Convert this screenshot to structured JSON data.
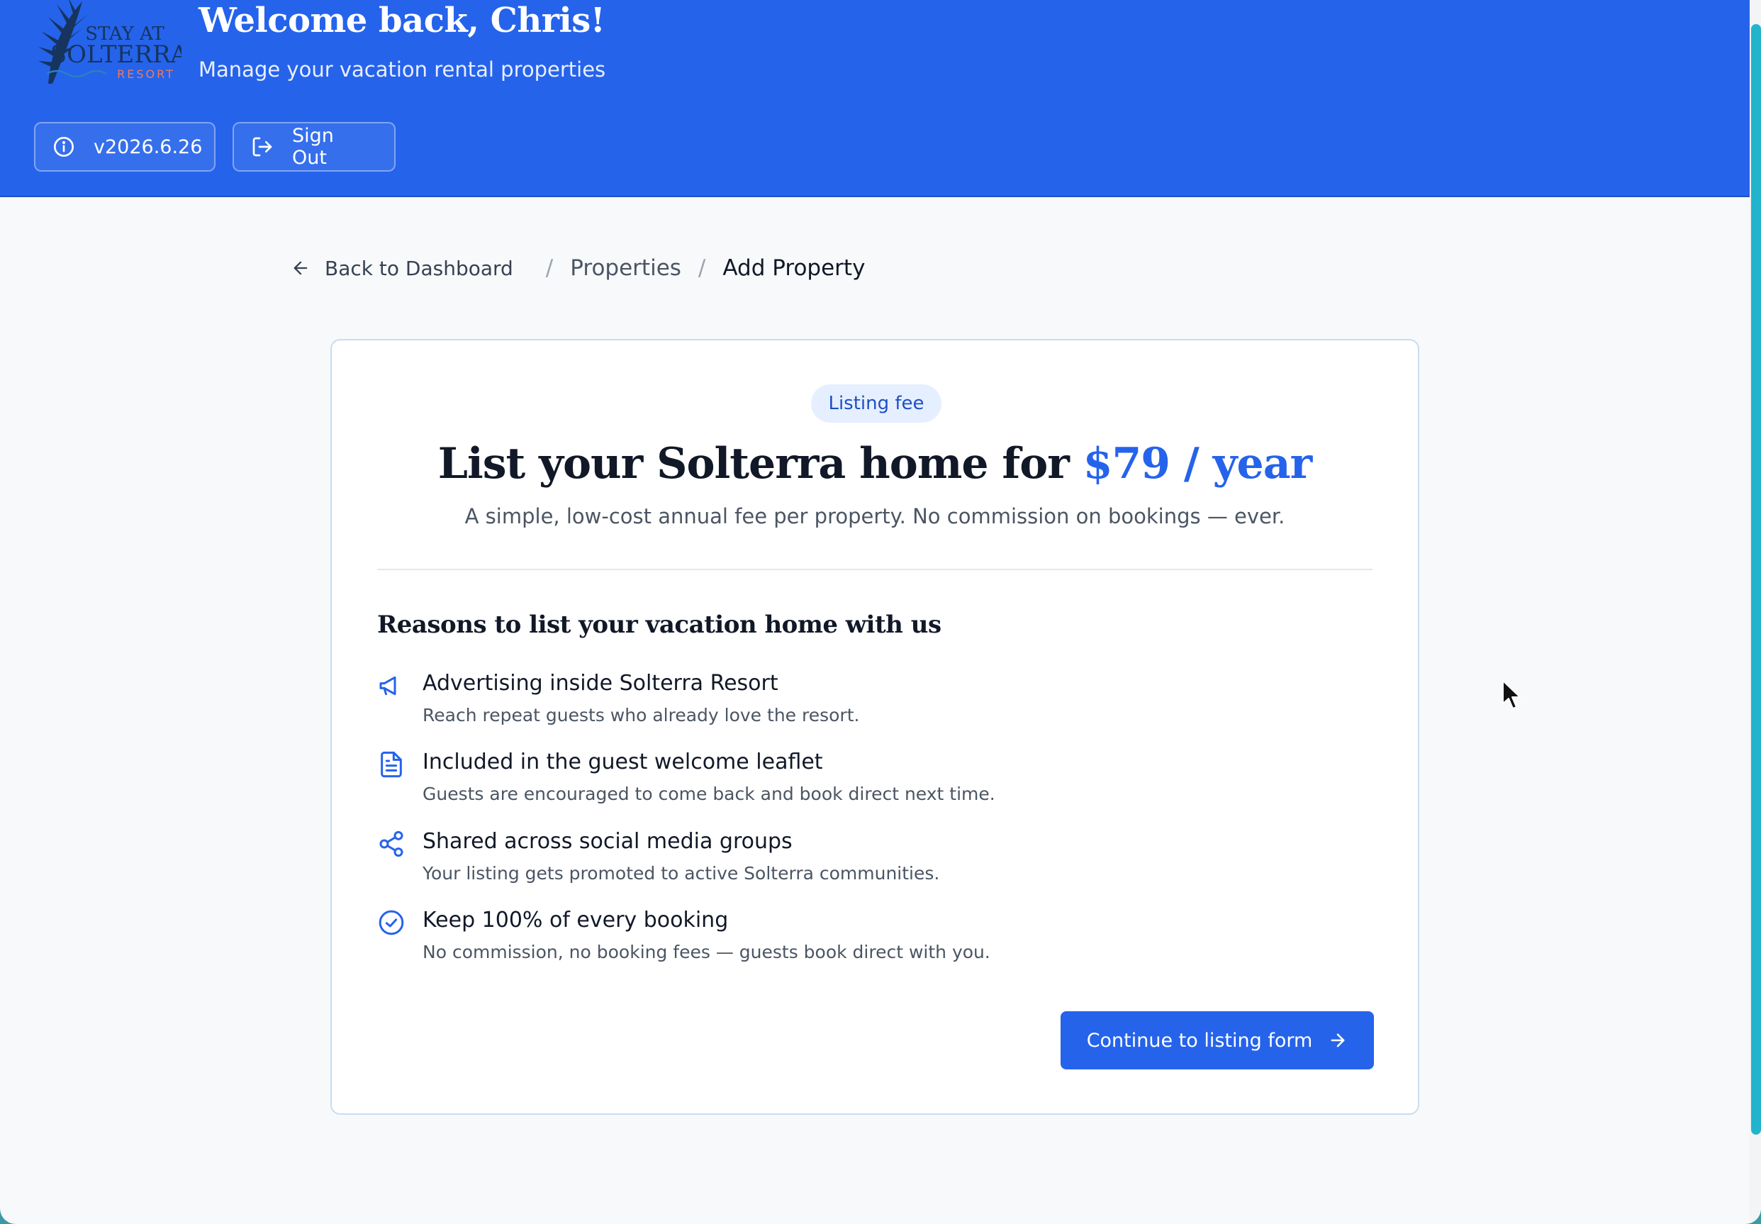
{
  "header": {
    "logo": {
      "line1": "STAY AT",
      "line2": "SOLTERRA",
      "line3": "RESORT",
      "icon": "palm-leaf-icon"
    },
    "welcome": "Welcome back, Chris!",
    "subtitle": "Manage your vacation rental properties",
    "version_label": "v2026.6.26",
    "version_icon": "info-icon",
    "signout_label": "Sign Out",
    "signout_icon": "sign-out-icon"
  },
  "breadcrumb": {
    "back_label": "Back to Dashboard",
    "separator": "/",
    "items": [
      "Properties",
      "Add Property"
    ]
  },
  "card": {
    "badge": "Listing fee",
    "headline_prefix": "List your Solterra home for ",
    "headline_price": "$79 / year",
    "lede": "A simple, low-cost annual fee per property. No commission on bookings — ever.",
    "reasons_title": "Reasons to list your vacation home with us",
    "reasons": [
      {
        "icon": "megaphone-icon",
        "title": "Advertising inside Solterra Resort",
        "desc": "Reach repeat guests who already love the resort."
      },
      {
        "icon": "document-icon",
        "title": "Included in the guest welcome leaflet",
        "desc": "Guests are encouraged to come back and book direct next time."
      },
      {
        "icon": "share-icon",
        "title": "Shared across social media groups",
        "desc": "Your listing gets promoted to active Solterra communities."
      },
      {
        "icon": "check-circle-icon",
        "title": "Keep 100% of every booking",
        "desc": "No commission, no booking fees — guests book direct with you."
      }
    ],
    "cta_label": "Continue to listing form"
  },
  "colors": {
    "brand_blue": "#2563eb",
    "header_bg": "#2563eb",
    "badge_bg": "#e6efff",
    "scrollbar": "#22b4cc",
    "logo_navy": "#16345e",
    "logo_coral": "#f07b5a"
  }
}
